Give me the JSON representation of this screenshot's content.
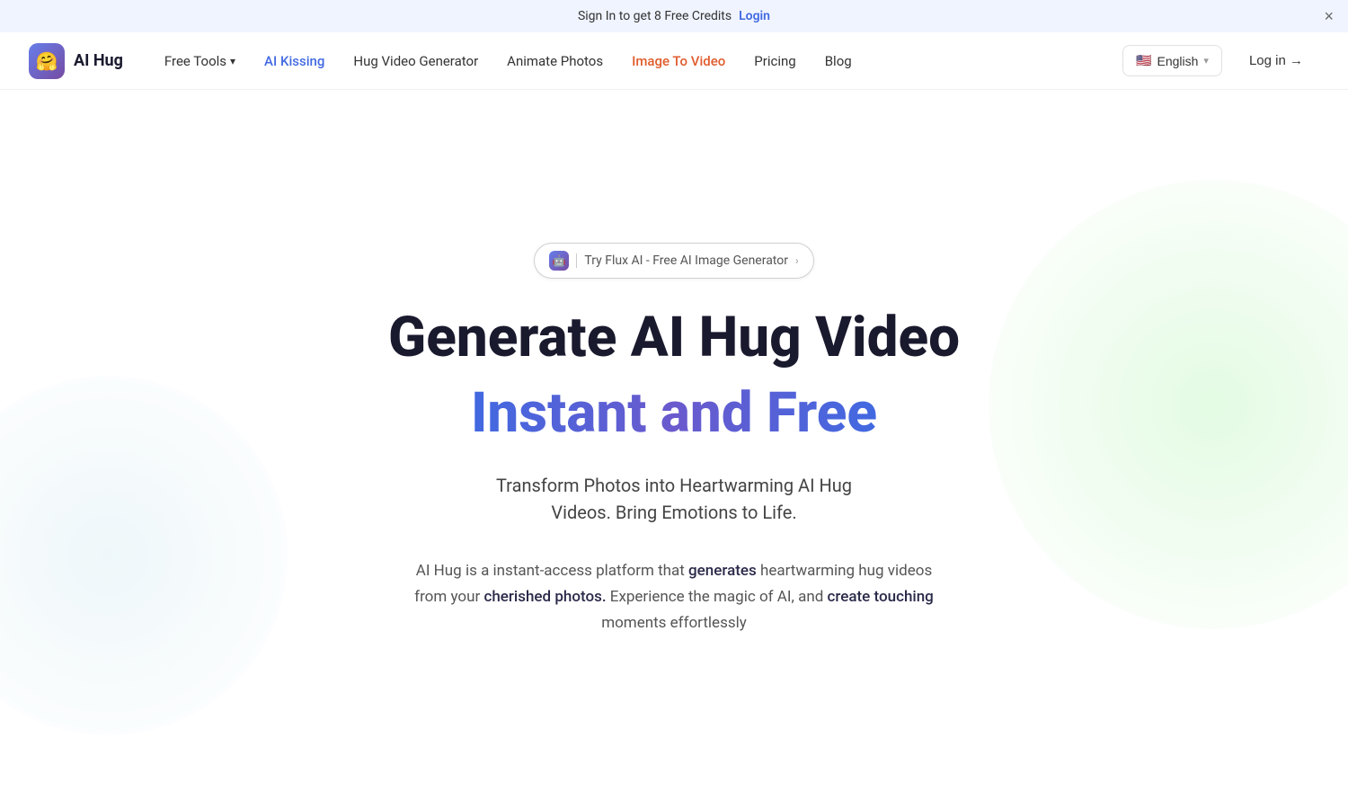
{
  "banner": {
    "text": "Sign In to get 8 Free Credits",
    "login_label": "Login",
    "close_label": "×"
  },
  "navbar": {
    "logo_text": "AI  Hug",
    "logo_emoji": "🤗",
    "nav_items": [
      {
        "label": "Free Tools",
        "id": "free-tools",
        "has_chevron": true,
        "style": "default"
      },
      {
        "label": "AI Kissing",
        "id": "ai-kissing",
        "style": "blue"
      },
      {
        "label": "Hug Video Generator",
        "id": "hug-video",
        "style": "default"
      },
      {
        "label": "Animate Photos",
        "id": "animate-photos",
        "style": "default"
      },
      {
        "label": "Image To Video",
        "id": "image-to-video",
        "style": "orange"
      },
      {
        "label": "Pricing",
        "id": "pricing",
        "style": "default"
      },
      {
        "label": "Blog",
        "id": "blog",
        "style": "default"
      }
    ],
    "lang_flag": "🇺🇸",
    "lang_label": "English",
    "login_label": "Log in →"
  },
  "hero": {
    "badge_text": "Try Flux AI - Free AI Image Generator",
    "badge_chevron": "›",
    "badge_icon": "🤖",
    "title_line1": "Generate AI Hug Video",
    "title_line2": "Instant and Free",
    "subtitle_line1": "Transform Photos into Heartwarming AI Hug",
    "subtitle_line2": "Videos. Bring Emotions to Life.",
    "desc_part1": "AI Hug is a instant-access platform that ",
    "desc_highlight1": "generates",
    "desc_part2": " heartwarming hug videos from your ",
    "desc_highlight2": "cherished photos.",
    "desc_part3": " Experience the magic of AI, and ",
    "desc_highlight3": "create touching",
    "desc_part4": " moments effortlessly"
  }
}
